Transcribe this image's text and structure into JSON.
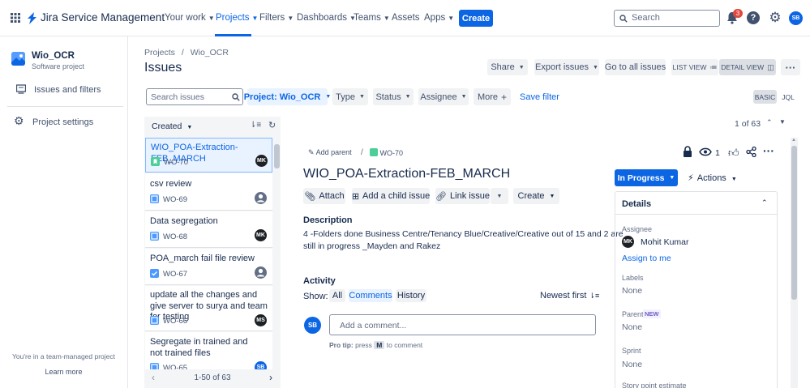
{
  "nav": {
    "app_name": "Jira Service Management",
    "items": [
      {
        "label": "Your work"
      },
      {
        "label": "Projects"
      },
      {
        "label": "Filters"
      },
      {
        "label": "Dashboards"
      },
      {
        "label": "Teams"
      },
      {
        "label": "Assets"
      },
      {
        "label": "Apps"
      }
    ],
    "create_label": "Create",
    "search_placeholder": "Search",
    "notification_count": "3",
    "user_initials": "SB"
  },
  "sidebar": {
    "project_name": "Wio_OCR",
    "project_type": "Software project",
    "items": [
      {
        "label": "Issues and filters"
      },
      {
        "label": "Project settings"
      }
    ],
    "footer_text": "You're in a team-managed project",
    "learn_more": "Learn more"
  },
  "header": {
    "breadcrumb_projects": "Projects",
    "breadcrumb_sep": "/",
    "breadcrumb_project": "Wio_OCR",
    "title": "Issues",
    "share": "Share",
    "export": "Export issues",
    "go_all": "Go to all issues",
    "list_view": "LIST VIEW",
    "detail_view": "DETAIL VIEW"
  },
  "filters": {
    "search_placeholder": "Search issues",
    "project": "Project: Wio_OCR",
    "type": "Type",
    "status": "Status",
    "assignee": "Assignee",
    "more": "More",
    "save_filter": "Save filter",
    "basic": "BASIC",
    "jql": "JQL"
  },
  "list": {
    "sort_label": "Created",
    "pagination": "1-50 of 63",
    "issues": [
      {
        "title": "WIO_POA-Extraction-FEB_MARCH",
        "key": "WO-70",
        "assignee": "MK"
      },
      {
        "title": "csv review",
        "key": "WO-69",
        "assignee": ""
      },
      {
        "title": "Data segregation",
        "key": "WO-68",
        "assignee": "MK"
      },
      {
        "title": "POA_march fail file review",
        "key": "WO-67",
        "assignee": ""
      },
      {
        "title": "update all the changes and give server to surya and team for testing",
        "key": "WO-66",
        "assignee": "MS"
      },
      {
        "title": "Segregate in trained and not trained files",
        "key": "WO-65",
        "assignee": "SB"
      }
    ]
  },
  "detail": {
    "counter": "1 of 63",
    "add_parent": "Add parent",
    "issue_key": "WO-70",
    "watch_count": "1",
    "title": "WIO_POA-Extraction-FEB_MARCH",
    "attach": "Attach",
    "add_child": "Add a child issue",
    "link_issue": "Link issue",
    "create": "Create",
    "description_label": "Description",
    "description_line1": "4 -Folders done Business Centre/Tenancy Blue/Creative/Creative out of 15 and 2  are",
    "description_line2": "still in progress _Mayden and Rakez",
    "activity_label": "Activity",
    "show_label": "Show:",
    "tab_all": "All",
    "tab_comments": "Comments",
    "tab_history": "History",
    "newest_first": "Newest first",
    "comment_placeholder": "Add a comment...",
    "pro_tip_bold": "Pro tip:",
    "pro_tip_press": "press",
    "pro_tip_key": "M",
    "pro_tip_rest": "to comment",
    "user_initials": "SB"
  },
  "side_panel": {
    "status": "In Progress",
    "actions": "Actions",
    "details_label": "Details",
    "assignee_label": "Assignee",
    "assignee_name": "Mohit Kumar",
    "assignee_initials": "MK",
    "assign_to_me": "Assign to me",
    "labels_label": "Labels",
    "labels_value": "None",
    "parent_label": "Parent",
    "parent_badge": "NEW",
    "parent_value": "None",
    "sprint_label": "Sprint",
    "sprint_value": "None",
    "story_point_label": "Story point estimate"
  },
  "colors": {
    "brand_blue": "#0c66e4",
    "avatar_dark": "#1d2125",
    "selected_bg": "#e9f2ff",
    "story_green": "#4bce97",
    "task_blue": "#4c9aff"
  }
}
